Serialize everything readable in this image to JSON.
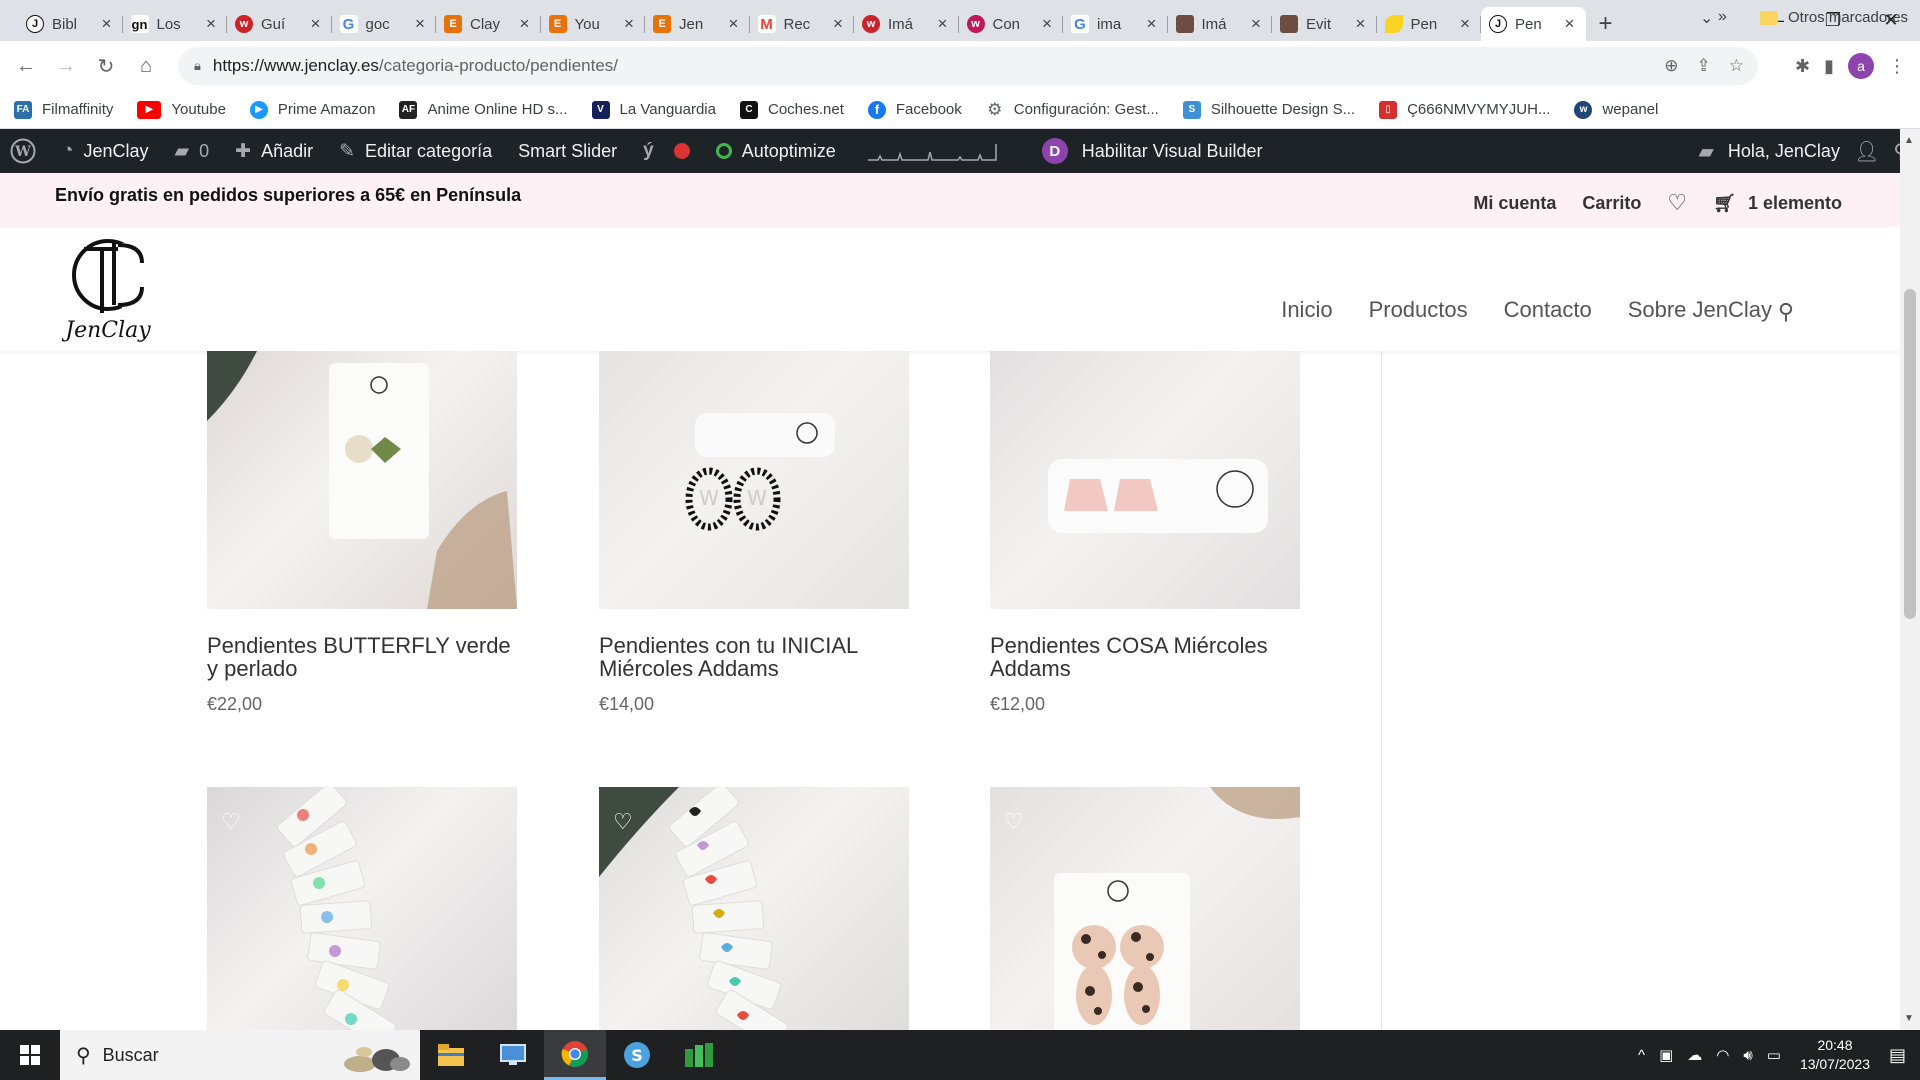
{
  "browser": {
    "tabs": [
      {
        "title": "Bibl",
        "favicon": "jenclay-logo",
        "color": "#ffffff"
      },
      {
        "title": "Los",
        "favicon": "gn",
        "color": "#ffffff"
      },
      {
        "title": "Guí",
        "favicon": "w",
        "color": "#cc2229"
      },
      {
        "title": "goc",
        "favicon": "G",
        "color": "#4285f4"
      },
      {
        "title": "Clay",
        "favicon": "E",
        "color": "#e8710a"
      },
      {
        "title": "You",
        "favicon": "E",
        "color": "#e8710a"
      },
      {
        "title": "Jen",
        "favicon": "E",
        "color": "#e8710a"
      },
      {
        "title": "Rec",
        "favicon": "M",
        "color": "#ea4335"
      },
      {
        "title": "Imá",
        "favicon": "w",
        "color": "#cc2229"
      },
      {
        "title": "Con",
        "favicon": "w",
        "color": "#c2185b"
      },
      {
        "title": "ima",
        "favicon": "G",
        "color": "#4285f4"
      },
      {
        "title": "Imá",
        "favicon": "photo",
        "color": "#6d4c41"
      },
      {
        "title": "Evit",
        "favicon": "photo",
        "color": "#6d4c41"
      },
      {
        "title": "Pen",
        "favicon": "leaf",
        "color": "#f9d423"
      },
      {
        "title": "Pen",
        "favicon": "jenclay-logo",
        "color": "#ffffff",
        "active": true
      }
    ],
    "new_tab": "+",
    "close_glyph": "×",
    "url_host": "https://www.jenclay.es",
    "url_path": "/categoria-producto/pendientes/",
    "profile_initial": "a"
  },
  "bookmarks": {
    "items": [
      {
        "label": "Filmaffinity",
        "icon": "FA",
        "color": "#2d6fa8"
      },
      {
        "label": "Youtube",
        "icon": "▶",
        "color": "#ff0000"
      },
      {
        "label": "Prime Amazon",
        "icon": "▶",
        "color": "#1a98ff"
      },
      {
        "label": "Anime Online HD s...",
        "icon": "AF",
        "color": "#222222"
      },
      {
        "label": "La Vanguardia",
        "icon": "V",
        "color": "#14215a"
      },
      {
        "label": "Coches.net",
        "icon": "C",
        "color": "#111111"
      },
      {
        "label": "Facebook",
        "icon": "f",
        "color": "#1877f2"
      },
      {
        "label": "Configuración: Gest...",
        "icon": "⚙",
        "color": "#5f6368"
      },
      {
        "label": "Silhouette Design S...",
        "icon": "S",
        "color": "#3d8fd6"
      },
      {
        "label": "Ç666NMVYMYJUH...",
        "icon": "▯",
        "color": "#d32f2f"
      },
      {
        "label": "wepanel",
        "icon": "w",
        "color": "#21447a"
      }
    ],
    "more": "»",
    "other": "Otros marcadores"
  },
  "wpbar": {
    "site": "JenClay",
    "comments": "0",
    "add": "Añadir",
    "edit": "Editar categoría",
    "slider": "Smart Slider",
    "autoptimize": "Autoptimize",
    "visual_builder": "Habilitar Visual Builder",
    "greeting": "Hola, JenClay"
  },
  "site": {
    "promo": "Envío gratis en pedidos superiores a 65€ en Península",
    "account": "Mi cuenta",
    "cart": "Carrito",
    "cart_items": "1 elemento",
    "logo_text": "JenClay",
    "nav": [
      "Inicio",
      "Productos",
      "Contacto",
      "Sobre JenClay"
    ]
  },
  "products": [
    {
      "name": "Pendientes BUTTERFLY verde y perlado",
      "price": "€22,00",
      "bg": "#ded8d5"
    },
    {
      "name": "Pendientes con tu INICIAL Miércoles Addams",
      "price": "€14,00",
      "bg": "#e6e3e3"
    },
    {
      "name": "Pendientes COSA Miércoles Addams",
      "price": "€12,00",
      "bg": "#e2dfe0"
    },
    {
      "name": "",
      "price": "",
      "bg": "#d9d7d8"
    },
    {
      "name": "",
      "price": "",
      "bg": "#dedbdb"
    },
    {
      "name": "",
      "price": "",
      "bg": "#e4e0dd"
    }
  ],
  "taskbar": {
    "search": "Buscar",
    "time": "20:48",
    "date": "13/07/2023"
  }
}
